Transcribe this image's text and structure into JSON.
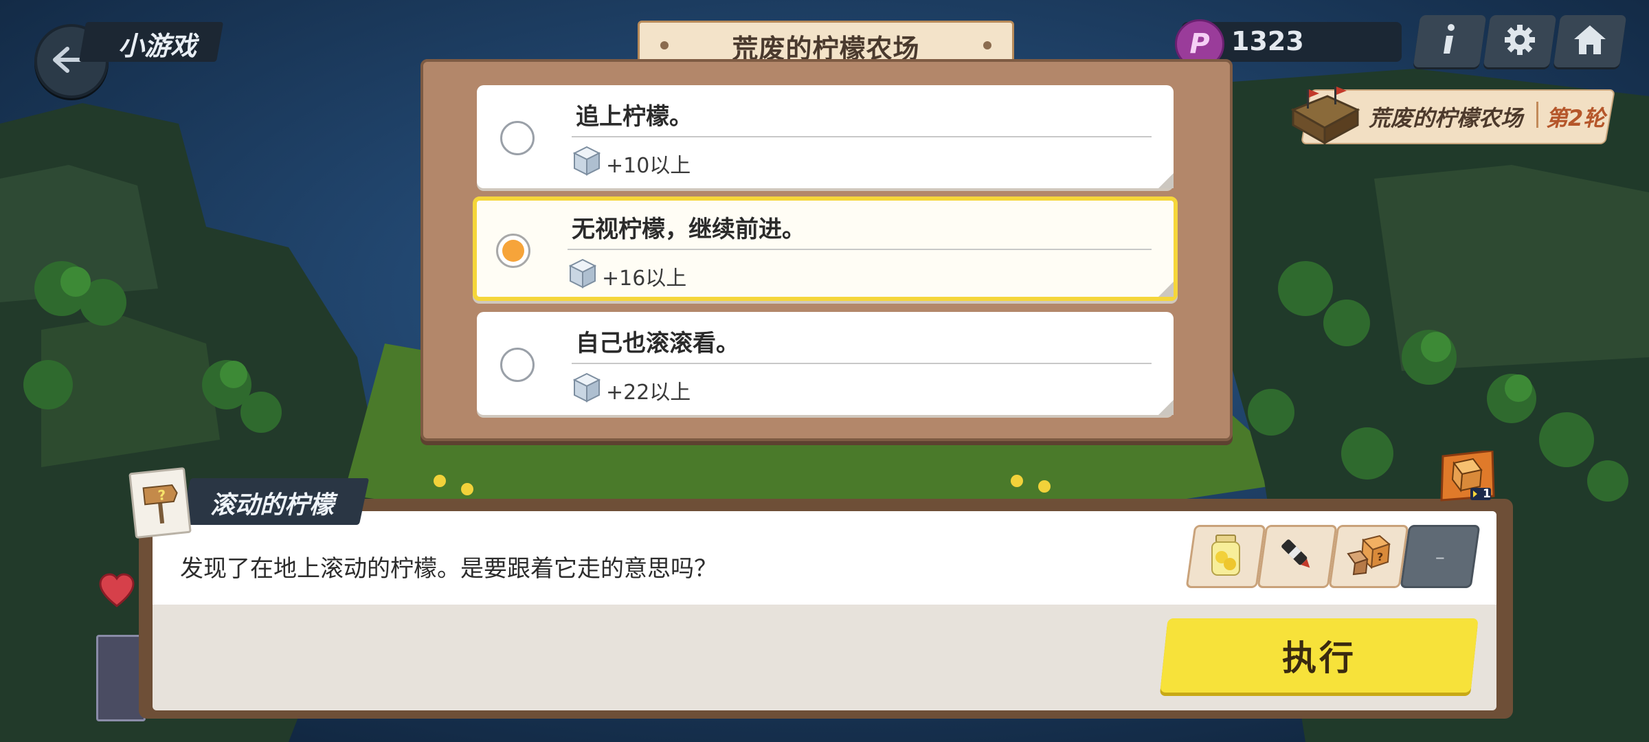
{
  "header": {
    "mode_label": "小游戏",
    "title": "荒废的柠檬农场",
    "points": "1323",
    "points_icon": "P"
  },
  "stage": {
    "name": "荒废的柠檬农场",
    "round": "第2轮"
  },
  "choices": [
    {
      "title": "追上柠檬。",
      "reward": "+10以上",
      "selected": false
    },
    {
      "title": "无视柠檬，继续前进。",
      "reward": "+16以上",
      "selected": true
    },
    {
      "title": "自己也滚滚看。",
      "reward": "+22以上",
      "selected": false
    }
  ],
  "event": {
    "name": "滚动的柠檬",
    "description": "发现了在地上滚动的柠檬。是要跟着它走的意思吗？",
    "empty_slot_label": "–",
    "dice_count": "1"
  },
  "execute_label": "执行",
  "colors": {
    "accent_yellow": "#f7e23a",
    "panel_brown": "#b3876a",
    "selected_border": "#f5d63a"
  }
}
